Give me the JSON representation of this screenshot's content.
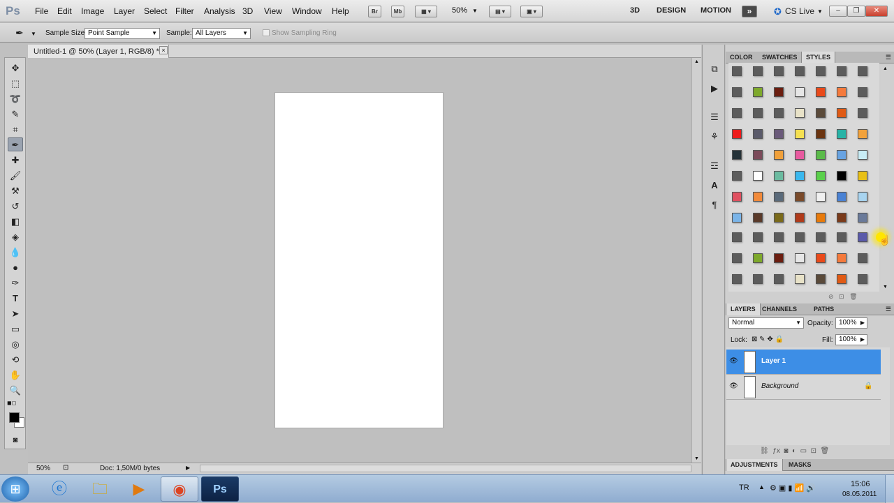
{
  "app": {
    "logo": "Ps"
  },
  "menu": [
    "File",
    "Edit",
    "Image",
    "Layer",
    "Select",
    "Filter",
    "Analysis",
    "3D",
    "View",
    "Window",
    "Help"
  ],
  "menubar_icons": {
    "br": "Br",
    "mb": "Mb",
    "zoom": "50%"
  },
  "workspaces": [
    "3D",
    "DESIGN",
    "MOTION"
  ],
  "cs_live": "CS Live",
  "options": {
    "sample_size_label": "Sample Size:",
    "sample_size_value": "Point Sample",
    "sample_label": "Sample:",
    "sample_value": "All Layers",
    "sampling_ring": "Show Sampling Ring"
  },
  "document": {
    "tab_title": "Untitled-1 @ 50% (Layer 1, RGB/8) *",
    "close": "×"
  },
  "status": {
    "zoom": "50%",
    "doc_info": "Doc: 1,50M/0 bytes"
  },
  "style_panel": {
    "tabs": [
      "COLOR",
      "SWATCHES",
      "STYLES"
    ],
    "active_tab": "STYLES"
  },
  "layers_panel": {
    "tabs": [
      "LAYERS",
      "CHANNELS",
      "PATHS"
    ],
    "blend_mode": "Normal",
    "opacity_label": "Opacity:",
    "opacity_value": "100%",
    "lock_label": "Lock:",
    "fill_label": "Fill:",
    "fill_value": "100%",
    "layers": [
      {
        "name": "Layer 1",
        "selected": true
      },
      {
        "name": "Background",
        "locked": true
      }
    ]
  },
  "bottom_panel": {
    "tabs": [
      "ADJUSTMENTS",
      "MASKS"
    ]
  },
  "taskbar": {
    "lang": "TR",
    "time": "15:06",
    "date": "08.05.2011"
  },
  "colors": {
    "accent": "#3d8ee6",
    "selection": "#3d8ee6"
  }
}
